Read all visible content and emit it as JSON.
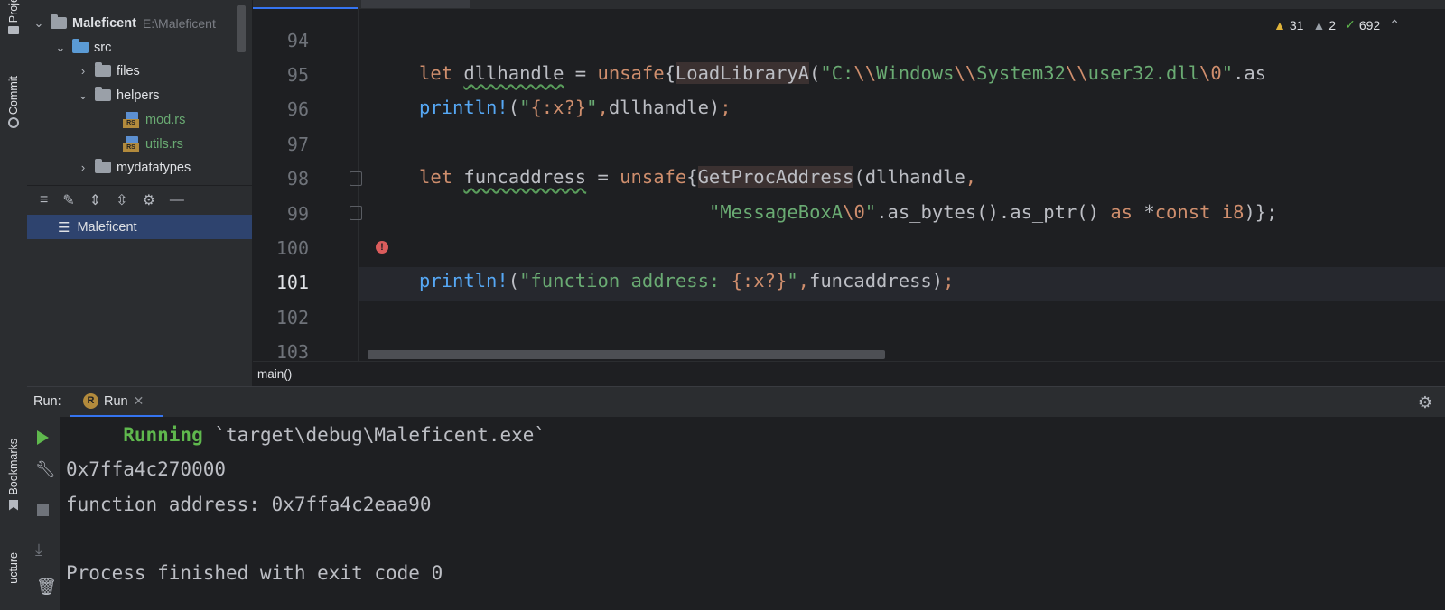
{
  "left_strip": {
    "project_tab": "Proje",
    "commit_tab": "Commit",
    "bookmarks_tab": "Bookmarks",
    "structure_tab": "ucture"
  },
  "project_tree": [
    {
      "label": "Maleficent",
      "path": "E:\\Maleficent",
      "type": "folder",
      "expanded": true
    },
    {
      "label": "src",
      "type": "folder",
      "expanded": true
    },
    {
      "label": "files",
      "type": "folder",
      "expanded": false
    },
    {
      "label": "helpers",
      "type": "folder",
      "expanded": true
    },
    {
      "label": "mod.rs",
      "type": "file"
    },
    {
      "label": "utils.rs",
      "type": "file"
    },
    {
      "label": "mydatatypes",
      "type": "folder",
      "expanded": false
    }
  ],
  "structure": {
    "item": "Maleficent"
  },
  "editor": {
    "line_numbers": [
      "94",
      "95",
      "96",
      "97",
      "98",
      "99",
      "100",
      "101",
      "102",
      "103"
    ],
    "current_line": "101",
    "inspections": {
      "warnings": "31",
      "weak_warnings": "2",
      "ok": "692"
    },
    "code": {
      "l95_let": "let ",
      "l95_var": "dllhandle",
      "l95_eq": " = ",
      "l95_unsafe": "unsafe",
      "l95_brace": "{",
      "l95_fn": "LoadLibraryA",
      "l95_paren": "(",
      "l95_s1": "\"C:",
      "l95_e1": "\\\\",
      "l95_s2": "Windows",
      "l95_e2": "\\\\",
      "l95_s3": "System32",
      "l95_e3": "\\\\",
      "l95_s4": "user32.dll",
      "l95_e4": "\\0",
      "l95_s5": "\"",
      "l95_tail": ".as",
      "l96_mac": "println!",
      "l96_open": "(",
      "l96_s1": "\"",
      "l96_fmt": "{:x?}",
      "l96_s2": "\"",
      "l96_comma": ",",
      "l96_arg": "dllhandle)",
      "l96_semi": ";",
      "l98_let": "let ",
      "l98_var": "funcaddress",
      "l98_eq": " = ",
      "l98_unsafe": "unsafe",
      "l98_brace": "{",
      "l98_fn": "GetProcAddress",
      "l98_arg": "(dllhandle",
      "l98_comma": ",",
      "l99_s1": "\"MessageBoxA",
      "l99_e1": "\\0",
      "l99_s2": "\"",
      "l99_rest": ".as_bytes().as_ptr() ",
      "l99_as": "as",
      "l99_star": " *",
      "l99_const": "const i8",
      "l99_close": ")};",
      "l101_mac": "println!",
      "l101_open": "(",
      "l101_s1": "\"function address: ",
      "l101_fmt": "{:x?}",
      "l101_s2": "\"",
      "l101_comma": ",",
      "l101_arg": "funcaddress)",
      "l101_semi": ";"
    },
    "breadcrumb": "main()"
  },
  "run_panel": {
    "label": "Run:",
    "tab": "Run",
    "console": {
      "running_word": "Running",
      "running_cmd": "`target\\debug\\Maleficent.exe`",
      "line2": "0x7ffa4c270000",
      "line3": "function address: 0x7ffa4c2eaa90",
      "line5": "Process finished with exit code 0"
    }
  },
  "colors": {
    "keyword": "#cf8e6d",
    "string": "#6aab73",
    "macro": "#56a8f5",
    "selection": "#2e436e",
    "running": "#5fb84d"
  }
}
